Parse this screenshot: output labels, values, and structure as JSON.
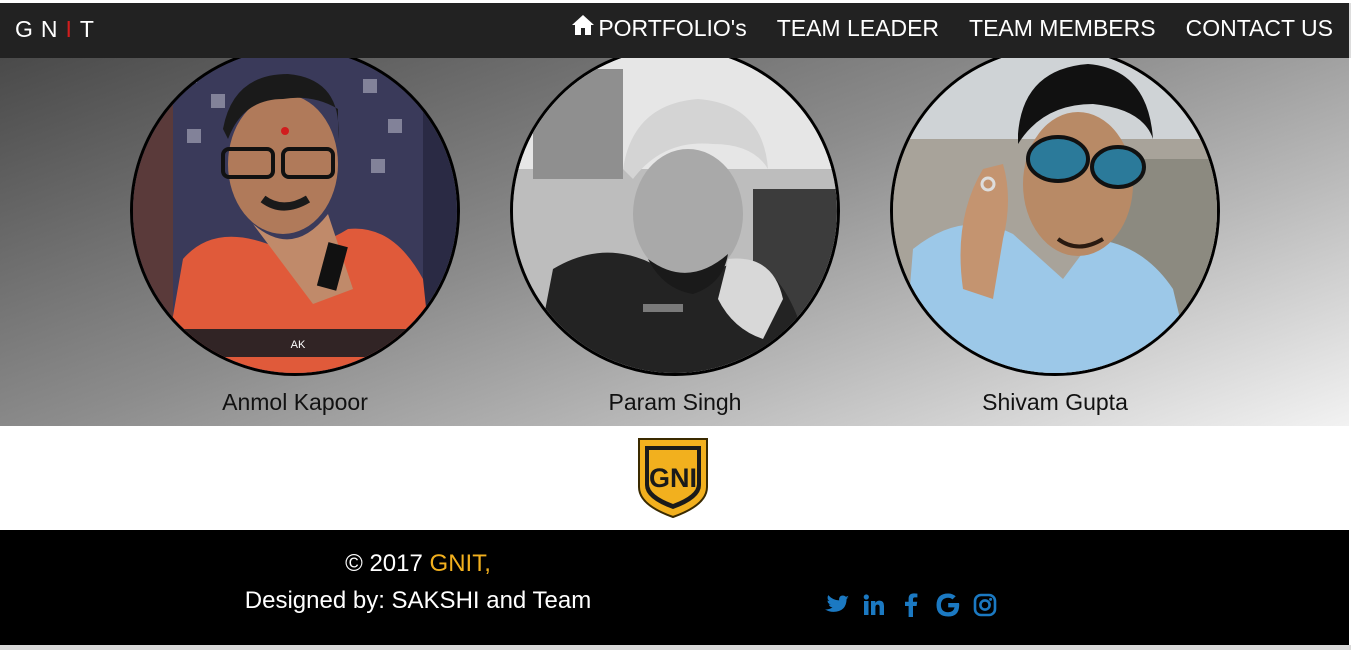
{
  "brand": {
    "letters": [
      "G",
      "N",
      "I",
      "T"
    ],
    "accent_color": "#d11d1d"
  },
  "nav": {
    "items": [
      {
        "label": "PORTFOLIO's",
        "icon": "home-icon"
      },
      {
        "label": "TEAM LEADER"
      },
      {
        "label": "TEAM MEMBERS"
      },
      {
        "label": "CONTACT US"
      }
    ]
  },
  "team": {
    "members": [
      {
        "name": "Anmol Kapoor",
        "photo_caption": "AK"
      },
      {
        "name": "Param Singh"
      },
      {
        "name": "Shivam Gupta"
      }
    ]
  },
  "logo": {
    "text": "GNI",
    "colors": {
      "fill": "#f2b01e",
      "text": "#1a1a1a"
    }
  },
  "footer": {
    "copyright": "© 2017 ",
    "brand": "GNIT,",
    "designed_by": "Designed by: SAKSHI and Team",
    "social": [
      "twitter-icon",
      "linkedin-icon",
      "facebook-icon",
      "google-icon",
      "instagram-icon"
    ],
    "social_color": "#1b79c2",
    "brand_color": "#f2b01e"
  }
}
